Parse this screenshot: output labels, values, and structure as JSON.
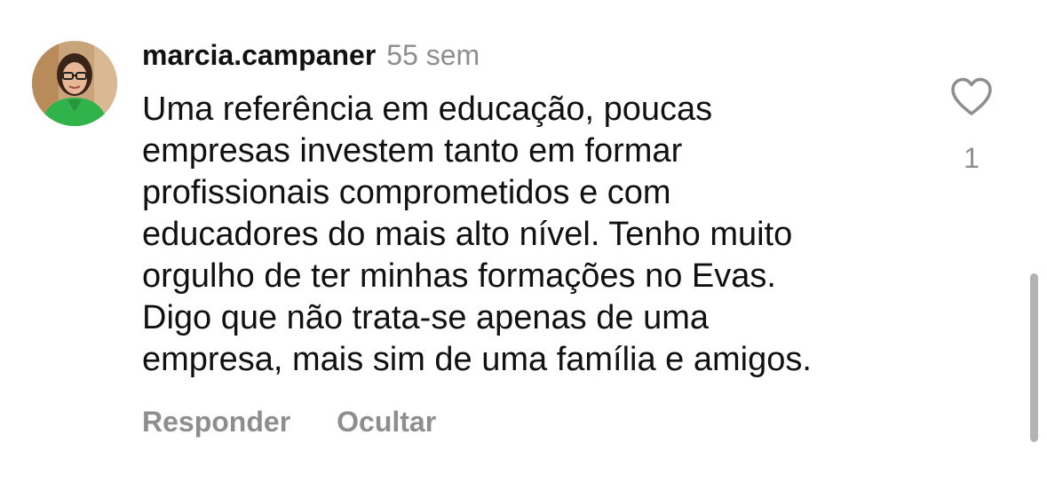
{
  "comment": {
    "username": "marcia.campaner",
    "timestamp": "55 sem",
    "text_lines": [
      "Uma referência em educação, poucas",
      "empresas investem tanto em formar",
      "profissionais comprometidos e com",
      "educadores do mais alto nível. Tenho muito",
      "orgulho de ter minhas formações no Evas.",
      "Digo que não trata-se apenas de uma",
      "empresa, mais sim de uma família e amigos."
    ],
    "actions": {
      "reply_label": "Responder",
      "hide_label": "Ocultar"
    },
    "likes": {
      "icon": "heart-outline-icon",
      "count": "1"
    }
  },
  "colors": {
    "text_primary": "#111111",
    "text_secondary": "#8e8e8e",
    "avatar_shirt": "#2fb34a",
    "scrollbar": "#b3b3b3"
  }
}
